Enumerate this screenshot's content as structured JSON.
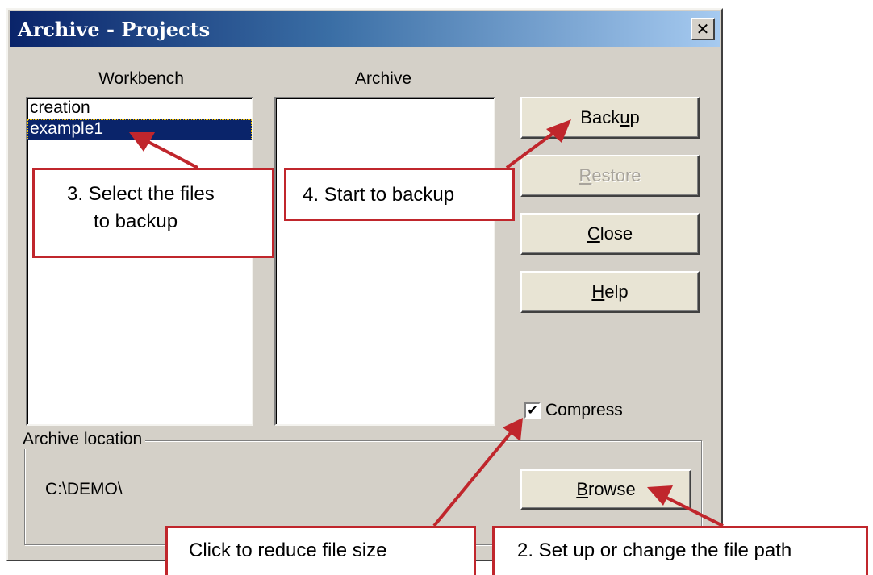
{
  "window": {
    "title": "Archive - Projects",
    "close_glyph": "✕"
  },
  "workbench": {
    "label": "Workbench",
    "items": [
      "creation",
      "example1"
    ],
    "selected_index": 1
  },
  "archive": {
    "label": "Archive",
    "items": []
  },
  "buttons": {
    "backup": {
      "pre": "Back",
      "key": "u",
      "post": "p"
    },
    "restore": {
      "pre": "",
      "key": "R",
      "post": "estore"
    },
    "close": {
      "pre": "",
      "key": "C",
      "post": "lose"
    },
    "help": {
      "pre": "",
      "key": "H",
      "post": "elp"
    },
    "browse": {
      "pre": "",
      "key": "B",
      "post": "rowse"
    }
  },
  "compress": {
    "label": "Compress",
    "checked": true,
    "check_glyph": "✔"
  },
  "archive_location": {
    "legend": "Archive location",
    "path": "C:\\DEMO\\"
  },
  "annotations": {
    "step3_line1": "3.  Select the files",
    "step3_line2": "to backup",
    "step4": "4. Start to backup",
    "compress_note": "Click to reduce file size",
    "step2": "2.  Set up or change the file path",
    "color": "#c0262c"
  }
}
